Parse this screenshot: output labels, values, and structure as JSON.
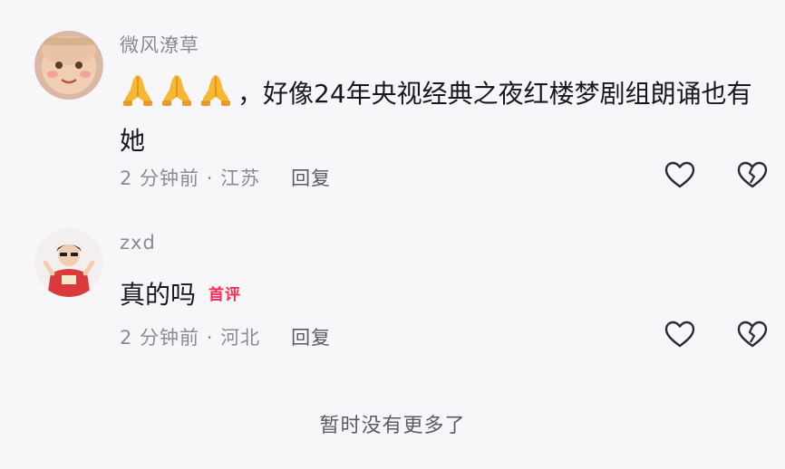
{
  "comments": [
    {
      "username": "微风潦草",
      "emoji": "pray-emoji",
      "text": "，好像24年央视经典之夜红楼梦剧组朗诵也有她",
      "time": "2 分钟前",
      "location": "江苏",
      "reply_label": "回复"
    },
    {
      "username": "zxd",
      "text": "真的吗",
      "badge": "首评",
      "time": "2 分钟前",
      "location": "河北",
      "reply_label": "回复"
    }
  ],
  "meta_separator": " · ",
  "footer_text": "暂时没有更多了",
  "colors": {
    "background": "#f7f7f9",
    "username": "#8a8b91",
    "text": "#161823",
    "badge": "#fe2c55"
  }
}
